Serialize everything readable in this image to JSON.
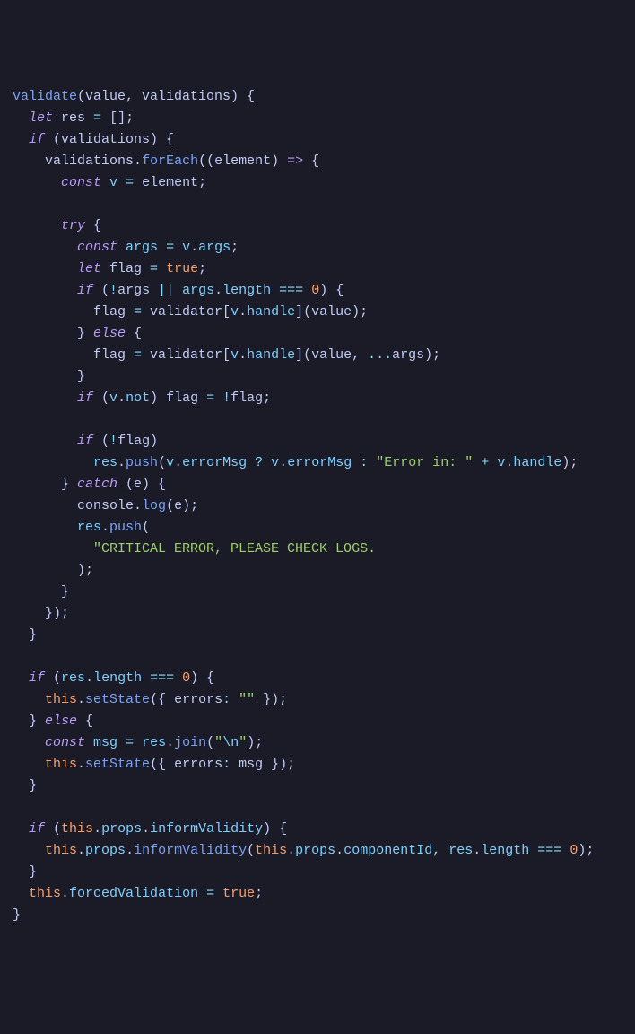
{
  "code": {
    "fn": "validate",
    "params_open": "(value, validations) {",
    "line2a": "let",
    "line2b": " res ",
    "line2c": "=",
    "line2d": " [];",
    "line3a": "if",
    "line3b": " (validations) {",
    "line4a": "validations",
    "line4b": ".",
    "line4c": "forEach",
    "line4d": "((element) ",
    "line4e": "=>",
    "line4f": " {",
    "line5a": "const",
    "line5b": " ",
    "line5c": "v",
    "line5d": " ",
    "line5e": "=",
    "line5f": " element;",
    "line7a": "try",
    "line7b": " {",
    "line8a": "const",
    "line8b": " ",
    "line8c": "args",
    "line8d": " ",
    "line8e": "=",
    "line8f": " ",
    "line8g": "v",
    "line8h": ".",
    "line8i": "args",
    "line8j": ";",
    "line9a": "let",
    "line9b": " flag ",
    "line9c": "=",
    "line9d": " ",
    "line9e": "true",
    "line9f": ";",
    "line10a": "if",
    "line10b": " (",
    "line10c": "!",
    "line10d": "args ",
    "line10e": "||",
    "line10f": " ",
    "line10g": "args",
    "line10h": ".",
    "line10i": "length",
    "line10j": " ",
    "line10k": "===",
    "line10l": " ",
    "line10m": "0",
    "line10n": ") {",
    "line11a": "flag ",
    "line11b": "=",
    "line11c": " validator[",
    "line11d": "v",
    "line11e": ".",
    "line11f": "handle",
    "line11g": "](value);",
    "line12a": "} ",
    "line12b": "else",
    "line12c": " {",
    "line13a": "flag ",
    "line13b": "=",
    "line13c": " validator[",
    "line13d": "v",
    "line13e": ".",
    "line13f": "handle",
    "line13g": "](value, ",
    "line13h": "...",
    "line13i": "args);",
    "line14": "}",
    "line15a": "if",
    "line15b": " (",
    "line15c": "v",
    "line15d": ".",
    "line15e": "not",
    "line15f": ") flag ",
    "line15g": "=",
    "line15h": " ",
    "line15i": "!",
    "line15j": "flag;",
    "line17a": "if",
    "line17b": " (",
    "line17c": "!",
    "line17d": "flag)",
    "line18a": "res",
    "line18b": ".",
    "line18c": "push",
    "line18d": "(",
    "line18e": "v",
    "line18f": ".",
    "line18g": "errorMsg",
    "line18h": " ",
    "line18i": "?",
    "line18j": " ",
    "line18k": "v",
    "line18l": ".",
    "line18m": "errorMsg",
    "line18n": " ",
    "line18o": ":",
    "line18p": " ",
    "line18q": "\"Error in: \"",
    "line18r": " ",
    "line18s": "+",
    "line18t": " ",
    "line18u": "v",
    "line18v": ".",
    "line18w": "handle",
    "line18x": ");",
    "line19a": "} ",
    "line19b": "catch",
    "line19c": " (e) {",
    "line20a": "console",
    "line20b": ".",
    "line20c": "log",
    "line20d": "(e);",
    "line21a": "res",
    "line21b": ".",
    "line21c": "push",
    "line21d": "(",
    "line22": "\"CRITICAL ERROR, PLEASE CHECK LOGS.                                 \"",
    "line23": ");",
    "line24": "}",
    "line25": "});",
    "line26": "}",
    "line28a": "if",
    "line28b": " (",
    "line28c": "res",
    "line28d": ".",
    "line28e": "length",
    "line28f": " ",
    "line28g": "===",
    "line28h": " ",
    "line28i": "0",
    "line28j": ") {",
    "line29a": "this",
    "line29b": ".",
    "line29c": "setState",
    "line29d": "({ errors",
    "line29e": ":",
    "line29f": " ",
    "line29g": "\"\"",
    "line29h": " });",
    "line30a": "} ",
    "line30b": "else",
    "line30c": " {",
    "line31a": "const",
    "line31b": " ",
    "line31c": "msg",
    "line31d": " ",
    "line31e": "=",
    "line31f": " ",
    "line31g": "res",
    "line31h": ".",
    "line31i": "join",
    "line31j": "(",
    "line31k": "\"",
    "line31l": "\\n",
    "line31m": "\"",
    "line31n": ");",
    "line32a": "this",
    "line32b": ".",
    "line32c": "setState",
    "line32d": "({ errors",
    "line32e": ":",
    "line32f": " msg });",
    "line33": "}",
    "line35a": "if",
    "line35b": " (",
    "line35c": "this",
    "line35d": ".",
    "line35e": "props",
    "line35f": ".",
    "line35g": "informValidity",
    "line35h": ") {",
    "line36a": "this",
    "line36b": ".",
    "line36c": "props",
    "line36d": ".",
    "line36e": "informValidity",
    "line36f": "(",
    "line36g": "this",
    "line36h": ".",
    "line36i": "props",
    "line36j": ".",
    "line36k": "componentId",
    "line36l": ", ",
    "line36m": "res",
    "line36n": ".",
    "line36o": "length",
    "line36p": " ",
    "line36q": "===",
    "line36r": " ",
    "line36s": "0",
    "line36t": ");",
    "line37": "}",
    "line38a": "this",
    "line38b": ".",
    "line38c": "forcedValidation",
    "line38d": " ",
    "line38e": "=",
    "line38f": " ",
    "line38g": "true",
    "line38h": ";",
    "line39": "}"
  }
}
